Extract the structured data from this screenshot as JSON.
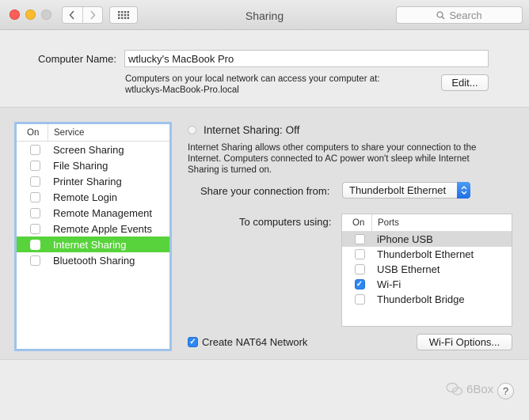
{
  "window": {
    "title": "Sharing",
    "search_placeholder": "Search"
  },
  "computer_name": {
    "label": "Computer Name:",
    "value": "wtlucky's MacBook Pro",
    "note_line1": "Computers on your local network can access your computer at:",
    "note_line2": "wtluckys-MacBook-Pro.local",
    "edit_label": "Edit..."
  },
  "services": {
    "header_on": "On",
    "header_service": "Service",
    "items": [
      {
        "label": "Screen Sharing",
        "checked": false,
        "selected": false
      },
      {
        "label": "File Sharing",
        "checked": false,
        "selected": false
      },
      {
        "label": "Printer Sharing",
        "checked": false,
        "selected": false
      },
      {
        "label": "Remote Login",
        "checked": false,
        "selected": false
      },
      {
        "label": "Remote Management",
        "checked": false,
        "selected": false
      },
      {
        "label": "Remote Apple Events",
        "checked": false,
        "selected": false
      },
      {
        "label": "Internet Sharing",
        "checked": false,
        "selected": true
      },
      {
        "label": "Bluetooth Sharing",
        "checked": false,
        "selected": false
      }
    ]
  },
  "internet_sharing": {
    "title": "Internet Sharing: Off",
    "description": "Internet Sharing allows other computers to share your connection to the Internet. Computers connected to AC power won't sleep while Internet Sharing is turned on.",
    "share_from_label": "Share your connection from:",
    "share_from_value": "Thunderbolt Ethernet",
    "to_computers_label": "To computers using:",
    "ports_header_on": "On",
    "ports_header_ports": "Ports",
    "ports": [
      {
        "label": "iPhone USB",
        "checked": false,
        "highlight": true
      },
      {
        "label": "Thunderbolt Ethernet",
        "checked": false,
        "highlight": false
      },
      {
        "label": "USB Ethernet",
        "checked": false,
        "highlight": false
      },
      {
        "label": "Wi-Fi",
        "checked": true,
        "highlight": false
      },
      {
        "label": "Thunderbolt Bridge",
        "checked": false,
        "highlight": false
      }
    ],
    "nat64_label": "Create NAT64 Network",
    "nat64_checked": true,
    "wifi_options_label": "Wi-Fi Options..."
  },
  "watermark": "6Box",
  "help_label": "?",
  "colors": {
    "selection": "#58d33b",
    "accent": "#2d86f3",
    "list_focus": "#9ec3ec"
  }
}
